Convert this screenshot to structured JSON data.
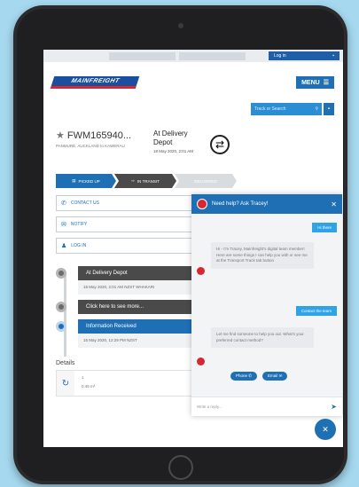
{
  "utility_bar": {
    "select_one": "",
    "select_two": "",
    "login_label": "Log in"
  },
  "header": {
    "logo_text": "MAINFREIGHT",
    "menu_label": "MENU"
  },
  "search": {
    "placeholder": "Track or Search"
  },
  "summary": {
    "tracking_number": "FWM165940...",
    "route": "PANMURE, AUCKLAND to KAWERAU",
    "status": "At Delivery Depot",
    "status_date": "18 May 2020, 2:01 AM"
  },
  "steps": [
    {
      "label": "PICKED UP"
    },
    {
      "label": "IN TRANSIT"
    },
    {
      "label": "DELIVERED"
    }
  ],
  "actions": [
    {
      "label": "CONTACT US",
      "icon": "phone-icon"
    },
    {
      "label": "NOTIFY",
      "icon": "mail-icon"
    },
    {
      "label": "LOG IN",
      "icon": "user-icon"
    }
  ],
  "timeline": [
    {
      "title": "At Delivery Depot",
      "detail": "18 May 2020, 2:01 AM NZST WHAKARI",
      "state": "grey"
    },
    {
      "title": "Click here to see more...",
      "detail": "",
      "state": "grey"
    },
    {
      "title": "Information Received",
      "detail": "15 May 2020, 12:29 PM NZST",
      "state": "blue"
    }
  ],
  "details": {
    "title": "Details",
    "cell_one": "1",
    "cell_two": "0.45 m³"
  },
  "chat": {
    "title": "Need help? Ask Tracey!",
    "messages": {
      "user_1": "Hi there",
      "bot_1": "Hi - I'm Tracey, Mainfreight's digital team member! Here are some things I can help you with or see me at the Transport Track tab button",
      "user_2": "Contact the team",
      "bot_2": "Let me find someone to help you out. What's your preferred contact method?"
    },
    "reply_phone": "Phone",
    "reply_email": "Email",
    "input_placeholder": "Write a reply..."
  },
  "colors": {
    "brand_blue": "#1f6fb5",
    "brand_red": "#d8282f"
  }
}
